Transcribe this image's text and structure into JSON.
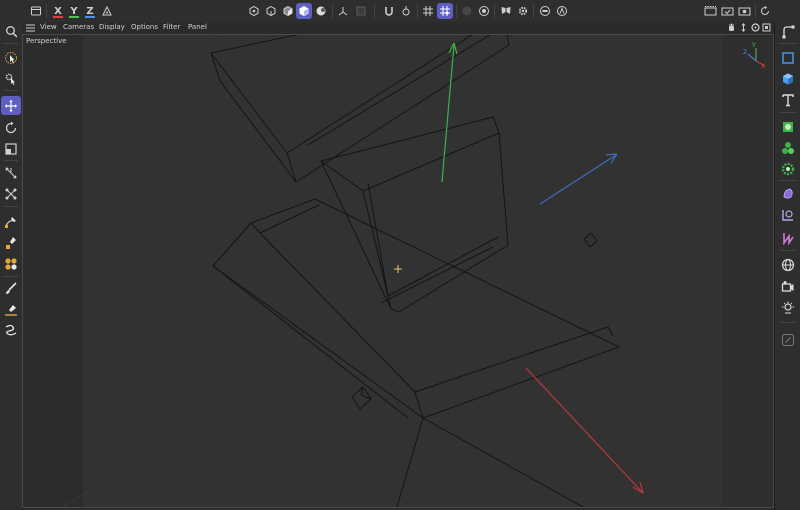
{
  "toolbar": {
    "axis_x": "X",
    "axis_y": "Y",
    "axis_z": "Z",
    "colors": {
      "x": "#e0423f",
      "y": "#4fc34d",
      "z": "#4b8ef0",
      "accent": "#5e5fc2"
    },
    "icons_left": [
      "undo-stack-icon",
      "axis-x-icon",
      "axis-y-icon",
      "axis-z-icon",
      "coordinate-system-icon"
    ],
    "icons_mode": [
      "points-mode-icon",
      "edges-mode-icon",
      "polygons-mode-icon",
      "model-mode-icon",
      "texture-mode-icon",
      "axis-mode-icon",
      "solo-icon"
    ],
    "icons_snap": [
      "magnet-snap-icon",
      "snap-settings-icon",
      "grid-snap-icon",
      "quantize-icon"
    ],
    "icons_right": [
      "render-view-icon",
      "render-picture-viewer-icon",
      "render-settings-icon",
      "refresh-icon"
    ]
  },
  "viewport": {
    "menu": [
      "View",
      "Cameras",
      "Display",
      "Options",
      "Filter",
      "Panel"
    ],
    "view_label": "Perspective"
  },
  "left_tools": [
    "search-icon",
    "live-selection-icon",
    "select-tools-icon",
    "move-icon",
    "rotate-icon",
    "scale-icon",
    "transform-icon",
    "points-tool-icon",
    "pen-tool-icon",
    "knife-tool-icon",
    "spline-tool-icon",
    "brush-tool-icon",
    "paint-tool-icon",
    "sketch-tool-icon"
  ],
  "right_tools": [
    "spline-curve-icon",
    "cube-primitive-icon",
    "cube-object-icon",
    "text-object-icon",
    "generator-icon",
    "mograph-cloner-icon",
    "effector-icon",
    "deformer-icon",
    "field-icon",
    "volume-icon",
    "environment-icon",
    "camera-icon",
    "light-icon",
    "tag-icon"
  ]
}
